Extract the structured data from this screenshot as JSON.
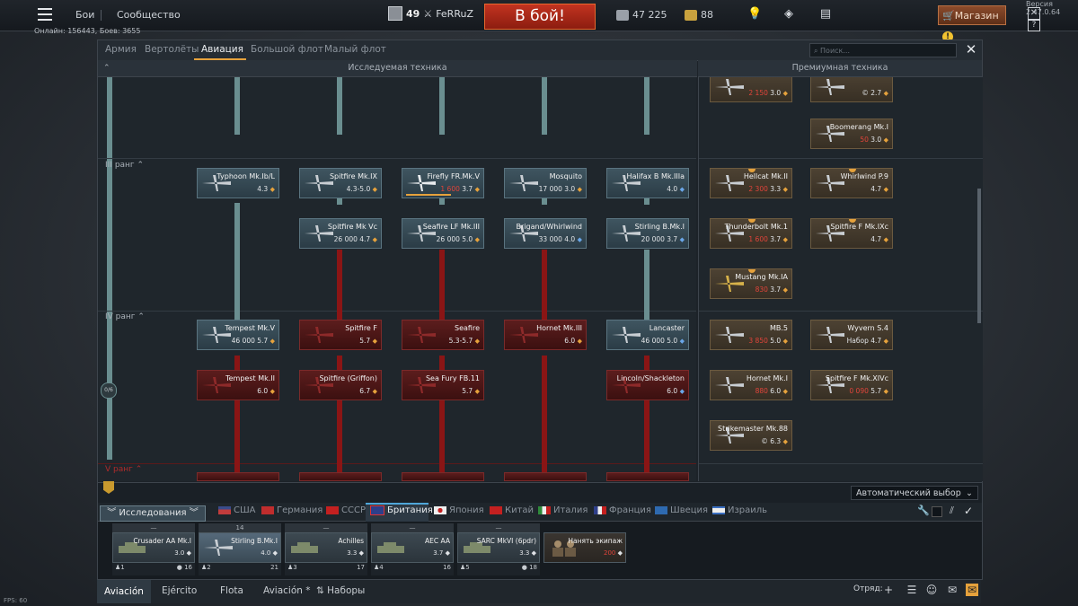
{
  "version": "Версия 2.47.0.64",
  "online": "Онлайн: 156443, Боев: 3655",
  "fps": "FPS: 60",
  "topbar": {
    "links": [
      "Бои",
      "Сообщество"
    ],
    "player_level": "49",
    "player_name": "FeRRuZ",
    "to_battle": "В бой!",
    "silver": "47 225",
    "gold": "88",
    "shop": "Магазин"
  },
  "tabs": [
    "Армия",
    "Вертолёты",
    "Авиация",
    "Большой флот",
    "Малый флот"
  ],
  "active_tab": "Авиация",
  "search_placeholder": "Поиск...",
  "sections": {
    "research": "Исследуемая техника",
    "premium": "Премиумная техника"
  },
  "ranks": {
    "r3": "III ранг",
    "r4": "IV ранг",
    "r5": "V ранг"
  },
  "progress": "0/6",
  "tree": {
    "row3a": [
      {
        "name": "Typhoon Mk.Ib/L",
        "price": "",
        "br": "4.3"
      },
      {
        "name": "Spitfire Mk.IX",
        "price": "",
        "br": "4.3-5.0"
      },
      {
        "name": "Firefly FR.Mk.V",
        "price": "1 600",
        "br": "3.7",
        "progress": 0.6
      },
      {
        "name": "Mosquito",
        "price": "17 000",
        "br": "3.0"
      },
      {
        "name": "Halifax B Mk.IIIa",
        "price": "",
        "br": "4.0"
      }
    ],
    "row3b": [
      {
        "name": "Spitfire Mk Vc",
        "price": "26 000",
        "br": "4.7"
      },
      {
        "name": "Seafire LF Mk.III",
        "price": "26 000",
        "br": "5.0"
      },
      {
        "name": "Brigand/Whirlwind",
        "price": "33 000",
        "br": "4.0"
      },
      {
        "name": "Stirling B.Mk.I",
        "price": "20 000",
        "br": "3.7"
      }
    ],
    "row4a": [
      {
        "name": "Tempest Mk.V",
        "price": "46 000",
        "br": "5.7"
      },
      {
        "name": "Spitfire F",
        "price": "",
        "br": "5.7"
      },
      {
        "name": "Seafire",
        "price": "",
        "br": "5.3-5.7"
      },
      {
        "name": "Hornet Mk.III",
        "price": "",
        "br": "6.0"
      },
      {
        "name": "Lancaster",
        "price": "46 000",
        "br": "5.0"
      }
    ],
    "row4b": [
      {
        "name": "Tempest Mk.II",
        "price": "",
        "br": "6.0"
      },
      {
        "name": "Spitfire (Griffon)",
        "price": "",
        "br": "6.7"
      },
      {
        "name": "Sea Fury FB.11",
        "price": "",
        "br": "5.7"
      },
      {
        "name": "Lincoln/Shackleton",
        "price": "",
        "br": "6.0"
      }
    ]
  },
  "premium": {
    "row0": [
      {
        "name": "",
        "price": "2 150",
        "br": "3.0"
      },
      {
        "name": "",
        "price": "",
        "br": "2.7"
      }
    ],
    "row1": [
      {
        "name": "Boomerang Mk.I",
        "price": "50",
        "br": "3.0"
      }
    ],
    "row3": [
      {
        "name": "Hellcat Mk.II",
        "price": "2 300",
        "br": "3.3"
      },
      {
        "name": "Whirlwind P.9",
        "price": "",
        "br": "4.7"
      },
      {
        "name": "Thunderbolt Mk.1",
        "price": "1 600",
        "br": "3.7"
      },
      {
        "name": "Spitfire F Mk.IXc",
        "price": "",
        "br": "4.7"
      },
      {
        "name": "Mustang Mk.IA",
        "price": "830",
        "br": "3.7"
      }
    ],
    "row4": [
      {
        "name": "MB.5",
        "price": "3 850",
        "br": "5.0"
      },
      {
        "name": "Wyvern S.4",
        "price": "Набор",
        "br": "4.7"
      },
      {
        "name": "Hornet Mk.I",
        "price": "880",
        "br": "6.0"
      },
      {
        "name": "Spitfire F Mk.XIVc",
        "price": "0 090",
        "br": "5.7"
      },
      {
        "name": "Strikemaster Mk.88",
        "price": "",
        "br": "6.3"
      }
    ]
  },
  "research_button": "Исследования",
  "auto_select": "Автоматический выбор",
  "nations": [
    "США",
    "Германия",
    "СССР",
    "Британия",
    "Япония",
    "Китай",
    "Италия",
    "Франция",
    "Швеция",
    "Израиль"
  ],
  "active_nation": "Британия",
  "crew": [
    {
      "top": "—",
      "name": "Crusader AA Mk.I",
      "br": "3.0",
      "num": "1",
      "count": "16"
    },
    {
      "top": "14",
      "name": "Stirling B.Mk.I",
      "br": "4.0",
      "num": "2",
      "count": "21"
    },
    {
      "top": "—",
      "name": "Achilles",
      "br": "3.3",
      "num": "3",
      "count": "17"
    },
    {
      "top": "—",
      "name": "AEC AA",
      "br": "3.7",
      "num": "4",
      "count": "16"
    },
    {
      "top": "—",
      "name": "SARC MkVI (6pdr)",
      "br": "3.3",
      "num": "5",
      "count": "18"
    },
    {
      "top": "",
      "name": "Нанять экипаж",
      "br": "",
      "price": "200",
      "num": "",
      "count": ""
    }
  ],
  "lower_tabs": [
    "Aviación",
    "Ejército",
    "Flota",
    "Aviación *",
    "Наборы"
  ],
  "squad_label": "Отряд:"
}
